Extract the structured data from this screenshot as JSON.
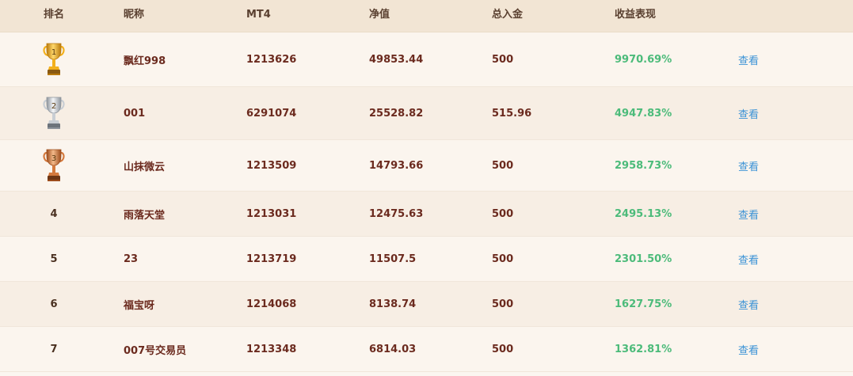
{
  "header": {
    "rank": "排名",
    "nickname": "昵称",
    "mt4": "MT4",
    "equity": "净值",
    "deposit": "总入金",
    "performance": "收益表现"
  },
  "rows": [
    {
      "rank": "1",
      "nickname": "飘红998",
      "mt4": "1213626",
      "equity": "49853.44",
      "deposit": "500",
      "performance": "9970.69%",
      "action": "查看",
      "trophy": "gold-trophy-icon"
    },
    {
      "rank": "2",
      "nickname": "001",
      "mt4": "6291074",
      "equity": "25528.82",
      "deposit": "515.96",
      "performance": "4947.83%",
      "action": "查看",
      "trophy": "silver-trophy-icon"
    },
    {
      "rank": "3",
      "nickname": "山抹微云",
      "mt4": "1213509",
      "equity": "14793.66",
      "deposit": "500",
      "performance": "2958.73%",
      "action": "查看",
      "trophy": "bronze-trophy-icon"
    },
    {
      "rank": "4",
      "nickname": "雨落天堂",
      "mt4": "1213031",
      "equity": "12475.63",
      "deposit": "500",
      "performance": "2495.13%",
      "action": "查看"
    },
    {
      "rank": "5",
      "nickname": "23",
      "mt4": "1213719",
      "equity": "11507.5",
      "deposit": "500",
      "performance": "2301.50%",
      "action": "查看"
    },
    {
      "rank": "6",
      "nickname": "福宝呀",
      "mt4": "1214068",
      "equity": "8138.74",
      "deposit": "500",
      "performance": "1627.75%",
      "action": "查看"
    },
    {
      "rank": "7",
      "nickname": "007号交易员",
      "mt4": "1213348",
      "equity": "6814.03",
      "deposit": "500",
      "performance": "1362.81%",
      "action": "查看"
    }
  ],
  "colors": {
    "header_bg": "#f2e5d4",
    "text": "#6b2a1e",
    "performance": "#4cbb7a",
    "link": "#3a92d6"
  }
}
